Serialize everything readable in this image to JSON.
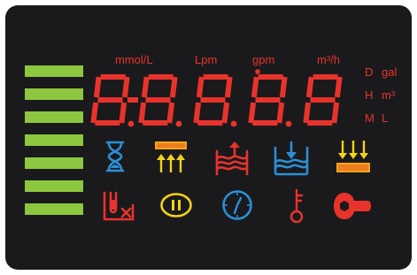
{
  "colors": {
    "panel": "#1a1a1c",
    "segment": "#e8332c",
    "bar": "#8dc73f",
    "icon_blue": "#2b8fd6",
    "icon_red": "#e8332c",
    "icon_yellow": "#f2d21b"
  },
  "level_bars": {
    "count": 7
  },
  "units_top": {
    "mmol": "mmol/L",
    "lpm": "Lpm",
    "gpm": "gpm",
    "m3h": "m³/h"
  },
  "units_side": {
    "d": "D",
    "gal": "gal",
    "h": "H",
    "m3": "m³",
    "m": "M",
    "l": "L"
  },
  "display": {
    "digits": [
      "8",
      "8",
      "8",
      "8",
      "8"
    ]
  },
  "icons": [
    "hourglass-icon",
    "backwash-up-icon",
    "brine-refill-icon",
    "brine-draw-icon",
    "service-down-icon",
    "salt-tank-icon",
    "pause-icon",
    "clock-icon",
    "key-icon",
    "wrench-icon"
  ]
}
